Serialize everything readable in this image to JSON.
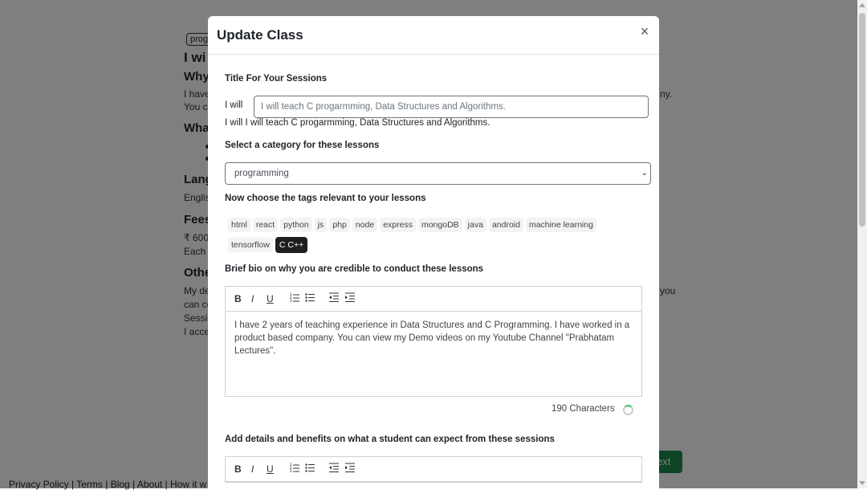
{
  "modal": {
    "title": "Update Class",
    "close_icon": "×",
    "title_label": "Title For Your Sessions",
    "title_prefix": "I will",
    "title_value": "I will teach C progarmming, Data Structures and Algorithms.",
    "title_preview": "I will I will teach C progarmming, Data Structures and Algorithms.",
    "category_label": "Select a category for these lessons",
    "category_value": "programming",
    "tags_label": "Now choose the tags relevant to your lessons",
    "tags": [
      "html",
      "react",
      "python",
      "js",
      "php",
      "node",
      "express",
      "mongoDB",
      "java",
      "android",
      "machine learning",
      "tensorflow",
      "C C++"
    ],
    "active_tag": "C C++",
    "bio_label": "Brief bio on why you are credible to conduct these lessons",
    "bio_text": "I have 2 years of teaching experience in Data Structures and C Programming. I have worked in a product based company. You can view my Demo videos on my Youtube Channel \"Prabhatam Lectures\".",
    "char_count": "190 Characters",
    "details_label": "Add details and benefits on what a student can expect from these sessions",
    "toolbar": {
      "bold": "B",
      "italic": "I",
      "underline": "U",
      "ordered_list": "ordered-list-icon",
      "bullet_list": "bullet-list-icon",
      "outdent": "outdent-icon",
      "indent": "indent-icon"
    }
  },
  "background": {
    "tag": "prog",
    "heading_1": "I wi",
    "heading_2": "Why",
    "text_1": "I have",
    "text_2": "You ca",
    "heading_3": "Wha",
    "heading_4": "Lang",
    "text_3": "Englis",
    "heading_5": "Fees",
    "text_4": "₹ 600",
    "text_5": "Each s",
    "heading_6": "Othe",
    "text_6": "My de",
    "text_7": "can co",
    "text_8": "Sessio",
    "text_9": "I acce",
    "right_1": "ny.",
    "right_2": "you",
    "next_button": "ext",
    "footer": "Privacy Policy | Terms | Blog | About | How it w"
  }
}
